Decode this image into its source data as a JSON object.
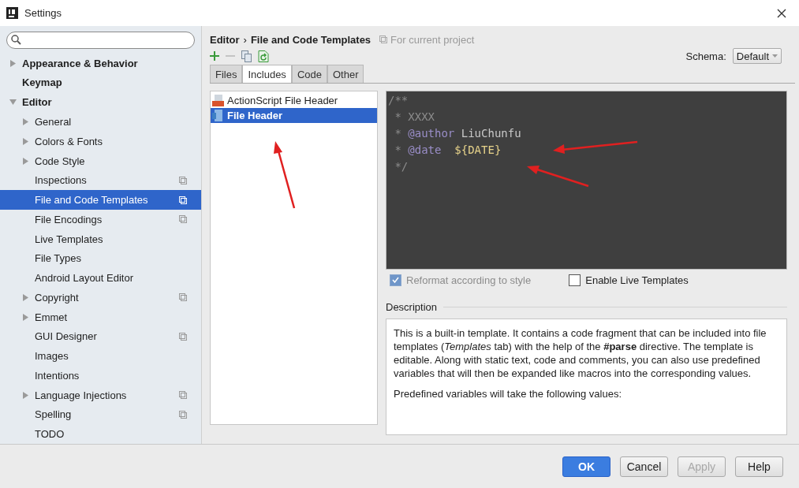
{
  "window": {
    "title": "Settings"
  },
  "sidebar": {
    "items": [
      {
        "label": "Appearance & Behavior",
        "expanded": false,
        "selected": false,
        "project_level": false
      },
      {
        "label": "Keymap",
        "selected": false,
        "project_level": false
      },
      {
        "label": "Editor",
        "expanded": true,
        "selected": false,
        "project_level": false,
        "children": [
          {
            "label": "General",
            "expanded": false,
            "selected": false,
            "project_level": false
          },
          {
            "label": "Colors & Fonts",
            "expanded": false,
            "selected": false,
            "project_level": false
          },
          {
            "label": "Code Style",
            "expanded": false,
            "selected": false,
            "project_level": false
          },
          {
            "label": "Inspections",
            "selected": false,
            "project_level": true
          },
          {
            "label": "File and Code Templates",
            "selected": true,
            "project_level": true
          },
          {
            "label": "File Encodings",
            "selected": false,
            "project_level": true
          },
          {
            "label": "Live Templates",
            "selected": false,
            "project_level": false
          },
          {
            "label": "File Types",
            "selected": false,
            "project_level": false
          },
          {
            "label": "Android Layout Editor",
            "selected": false,
            "project_level": false
          },
          {
            "label": "Copyright",
            "expanded": false,
            "selected": false,
            "project_level": true
          },
          {
            "label": "Emmet",
            "expanded": false,
            "selected": false,
            "project_level": false
          },
          {
            "label": "GUI Designer",
            "selected": false,
            "project_level": true
          },
          {
            "label": "Images",
            "selected": false,
            "project_level": false
          },
          {
            "label": "Intentions",
            "selected": false,
            "project_level": false
          },
          {
            "label": "Language Injections",
            "expanded": false,
            "selected": false,
            "project_level": true
          },
          {
            "label": "Spelling",
            "selected": false,
            "project_level": true
          },
          {
            "label": "TODO",
            "selected": false,
            "project_level": false
          }
        ]
      }
    ]
  },
  "breadcrumb": {
    "parent": "Editor",
    "separator": "›",
    "current": "File and Code Templates",
    "scope": "For current project"
  },
  "schema": {
    "label": "Schema:",
    "value": "Default"
  },
  "tabs": [
    {
      "label": "Files",
      "selected": false
    },
    {
      "label": "Includes",
      "selected": true
    },
    {
      "label": "Code",
      "selected": false
    },
    {
      "label": "Other",
      "selected": false
    }
  ],
  "templates": [
    {
      "label": "ActionScript File Header",
      "kind": "actionscript",
      "selected": false
    },
    {
      "label": "File Header",
      "kind": "java",
      "selected": true
    }
  ],
  "code_lines": [
    [
      {
        "kind": "comment",
        "text": "/**"
      }
    ],
    [
      {
        "kind": "comment",
        "text": " * XXXX"
      }
    ],
    [
      {
        "kind": "comment",
        "text": " * "
      },
      {
        "kind": "tag",
        "text": "@author"
      },
      {
        "kind": "value",
        "text": " LiuChunfu"
      }
    ],
    [
      {
        "kind": "comment",
        "text": " * "
      },
      {
        "kind": "tag",
        "text": "@date"
      },
      {
        "kind": "variable",
        "text": "  ${DATE}"
      }
    ],
    [
      {
        "kind": "comment",
        "text": " */"
      }
    ]
  ],
  "options": [
    {
      "label": "Reformat according to style",
      "checked": true,
      "disabled": true
    },
    {
      "label": "Enable Live Templates",
      "checked": false,
      "disabled": false
    }
  ],
  "description": {
    "title": "Description",
    "paragraphs": [
      "This is a built-in template. It contains a code fragment that can be included into file templates (*Templates* tab) with the help of the **#parse** directive. The template is editable. Along with static text, code and comments, you can also use predefined variables that will then be expanded like macros into the corresponding values.",
      "Predefined variables will take the following values:"
    ]
  },
  "buttons": [
    {
      "label": "OK",
      "primary": true,
      "disabled": false
    },
    {
      "label": "Cancel",
      "primary": false,
      "disabled": false
    },
    {
      "label": "Apply",
      "primary": false,
      "disabled": true
    },
    {
      "label": "Help",
      "primary": false,
      "disabled": false
    }
  ]
}
